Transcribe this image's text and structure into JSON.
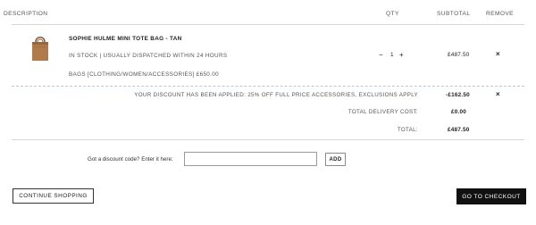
{
  "table": {
    "headers": {
      "description": "DESCRIPTION",
      "qty": "QTY",
      "subtotal": "SUBTOTAL",
      "remove": "REMOVE"
    }
  },
  "item": {
    "name": "SOPHIE HULME MINI TOTE BAG - TAN",
    "stock": "IN STOCK | USUALLY DISPATCHED WITHIN 24 HOURS",
    "category": "BAGS [CLOTHING/WOMEN/ACCESSORIES] £650.00",
    "qty_minus": "−",
    "qty": "1",
    "qty_plus": "+",
    "subtotal": "£487.50",
    "remove": "×",
    "image_color": "#b07a4a"
  },
  "summary": {
    "discount_label": "YOUR DISCOUNT HAS BEEN APPLIED: 25% OFF FULL PRICE ACCESSORIES, EXCLUSIONS APPLY",
    "discount_value": "-£162.50",
    "discount_remove": "×",
    "delivery_label": "TOTAL DELIVERY COST:",
    "delivery_value": "£0.00",
    "total_label": "TOTAL:",
    "total_value": "£487.50"
  },
  "discount_code": {
    "label": "Got a discount code? Enter it here:",
    "value": "",
    "button": "ADD"
  },
  "actions": {
    "continue": "CONTINUE SHOPPING",
    "checkout": "GO TO CHECKOUT"
  },
  "colors": {
    "checkout_bg": "#111111",
    "rule": "#d6d6d6"
  }
}
